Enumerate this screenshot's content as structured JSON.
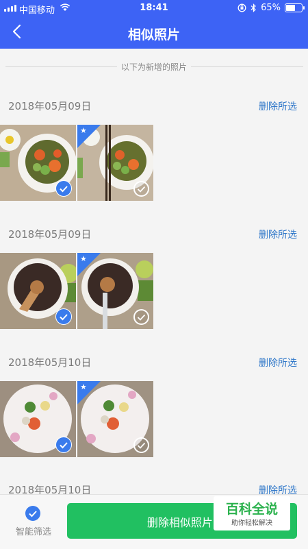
{
  "status": {
    "carrier": "中国移动",
    "time": "18:41",
    "battery": "65%",
    "battery_level": 0.65
  },
  "header": {
    "title": "相似照片"
  },
  "notice": "以下为新增的照片",
  "groups": [
    {
      "date": "2018年05月09日",
      "delete_label": "删除所选"
    },
    {
      "date": "2018年05月09日",
      "delete_label": "删除所选"
    },
    {
      "date": "2018年05月10日",
      "delete_label": "删除所选"
    },
    {
      "date": "2018年05月10日",
      "delete_label": "删除所选"
    }
  ],
  "bottom": {
    "filter_label": "智能筛选",
    "delete_button": "删除相似照片("
  },
  "watermark": {
    "title": "百科全说",
    "subtitle": "助你轻松解决"
  },
  "colors": {
    "accent": "#3d63f5",
    "link": "#2f77c9",
    "check": "#3a7bec",
    "button": "#21c061"
  }
}
